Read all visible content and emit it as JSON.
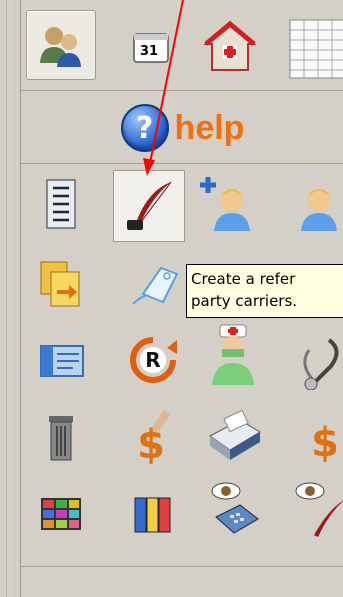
{
  "help": {
    "label": "help",
    "icon": "question-circle-icon"
  },
  "tooltip": {
    "line1": "Create a refer",
    "line2": "party carriers."
  },
  "top_toolbar": {
    "icons": [
      "users-group-icon",
      "calendar-icon",
      "hospital-house-icon",
      "spreadsheet-icon"
    ],
    "calendar_day": "31",
    "selected": "users-group-icon"
  },
  "grid_icons": [
    [
      "list-document-icon",
      "quill-pen-icon",
      "add-patient-icon",
      "patient-icon"
    ],
    [
      "documents-transfer-icon",
      "label-tag-icon",
      "",
      ""
    ],
    [
      "id-card-icon",
      "registered-refresh-icon",
      "doctor-icon",
      "stethoscope-icon"
    ],
    [
      "trash-can-icon",
      "dollar-motion-icon",
      "fax-printer-icon",
      "dollar-icon"
    ],
    [
      "color-grid-icon",
      "color-columns-icon",
      "eye-phone-icon",
      "eye-pen-icon"
    ]
  ],
  "colors": {
    "background": "#d4d0c8",
    "help_text": "#f07010",
    "tooltip_bg": "#ffffe1",
    "arrow": "#ff0000"
  }
}
